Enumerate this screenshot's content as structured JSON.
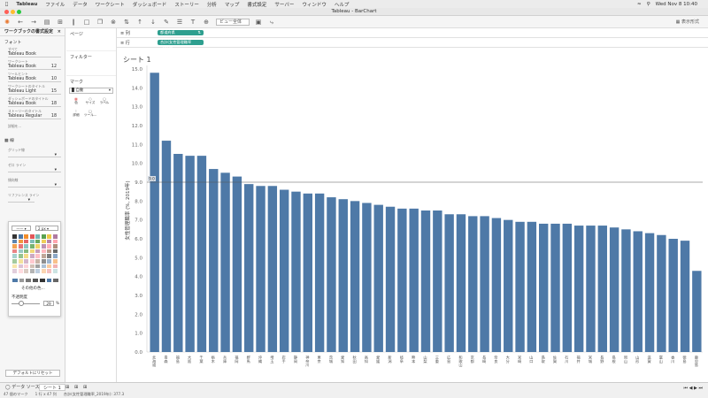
{
  "menubar": {
    "items": [
      "Tableau",
      "ファイル",
      "データ",
      "ワークシート",
      "ダッシュボード",
      "ストーリー",
      "分析",
      "マップ",
      "書式設定",
      "サーバー",
      "ウィンドウ",
      "ヘルプ"
    ],
    "clock": "Wed Nov 8  10:40"
  },
  "window": {
    "title": "Tableau - BarChart"
  },
  "toolbar": {
    "fit_select": "ビュー全体",
    "show_me": "表示形式"
  },
  "left_pane": {
    "title": "ワークブックの書式設定",
    "font_section": "フォント",
    "fonts": [
      {
        "label": "すべて",
        "value": "Tableau Book",
        "size": ""
      },
      {
        "label": "ワークシート",
        "value": "Tableau Book",
        "size": "12"
      },
      {
        "label": "ツールヒント",
        "value": "Tableau Book",
        "size": "10"
      },
      {
        "label": "ワークシートのタイトル",
        "value": "Tableau Light",
        "size": "15"
      },
      {
        "label": "ダッシュボードのタイトル",
        "value": "Tableau Book",
        "size": "18"
      },
      {
        "label": "ストーリーのタイトル",
        "value": "Tableau Regular",
        "size": "18"
      }
    ],
    "more": "詳細を...",
    "lines_section": "線",
    "line_rows": [
      "グリッド線",
      "ゼロ ライン",
      "傾向線",
      "リファレンス ライン"
    ],
    "line_weight": "2 px",
    "more_colors": "その他の色...",
    "opacity_label": "不透明度",
    "opacity_value": "29",
    "opacity_unit": "%",
    "reset_button": "デフォルトにリセット"
  },
  "cards": {
    "pages": "ページ",
    "filters": "フィルター",
    "marks": "マーク",
    "mark_type": "自動",
    "mark_buttons": [
      "色",
      "サイズ",
      "ラベル",
      "詳細",
      "ツール..."
    ]
  },
  "shelves": {
    "columns_label": "列",
    "columns_pill": "都道府県",
    "rows_label": "行",
    "rows_pill": "合計(女性管理職率_2019)"
  },
  "sheet": {
    "title": "シート 1"
  },
  "statusbar": {
    "tabs": [
      "データ ソース",
      "シート 1"
    ],
    "info": [
      "47 個のマーク",
      "1 行 x 47 列",
      "合計(女性管理職率_2019年): 377.3"
    ]
  },
  "chart_data": {
    "type": "bar",
    "ylabel": "女性管理職率 (%, 2019年)",
    "ylim": [
      0,
      15
    ],
    "yticks": [
      "0.0",
      "1.0",
      "2.0",
      "3.0",
      "4.0",
      "5.0",
      "6.0",
      "7.0",
      "8.0",
      "9.0",
      "10.0",
      "11.0",
      "12.0",
      "13.0",
      "14.0",
      "15.0"
    ],
    "reference_line": {
      "value": 9.0,
      "label": "9.0"
    },
    "bar_color": "#4e79a7",
    "categories": [
      "北海道",
      "青森",
      "福島",
      "大阪",
      "千葉",
      "栃木",
      "兵庫",
      "福岡",
      "群馬",
      "沖縄",
      "埼玉",
      "岩手",
      "静岡",
      "神奈川",
      "東京",
      "茨城",
      "愛知",
      "秋田",
      "高知",
      "愛媛",
      "新潟",
      "岐阜",
      "熊本",
      "山梨",
      "三重",
      "広島",
      "和歌山",
      "京都",
      "長崎",
      "奈良",
      "大分",
      "宮崎",
      "山口",
      "鳥取",
      "佐賀",
      "石川",
      "福井",
      "宮城",
      "長野",
      "島根",
      "岡山",
      "山形",
      "滋賀",
      "富山",
      "香川",
      "徳島",
      "鹿児島"
    ],
    "values": [
      14.8,
      11.2,
      10.5,
      10.4,
      10.4,
      9.7,
      9.5,
      9.3,
      8.9,
      8.8,
      8.8,
      8.6,
      8.5,
      8.4,
      8.4,
      8.2,
      8.1,
      8.0,
      7.9,
      7.8,
      7.7,
      7.6,
      7.6,
      7.5,
      7.5,
      7.3,
      7.3,
      7.2,
      7.2,
      7.1,
      7.0,
      6.9,
      6.9,
      6.8,
      6.8,
      6.8,
      6.7,
      6.7,
      6.7,
      6.6,
      6.5,
      6.4,
      6.3,
      6.2,
      6.0,
      5.9,
      4.3
    ]
  }
}
